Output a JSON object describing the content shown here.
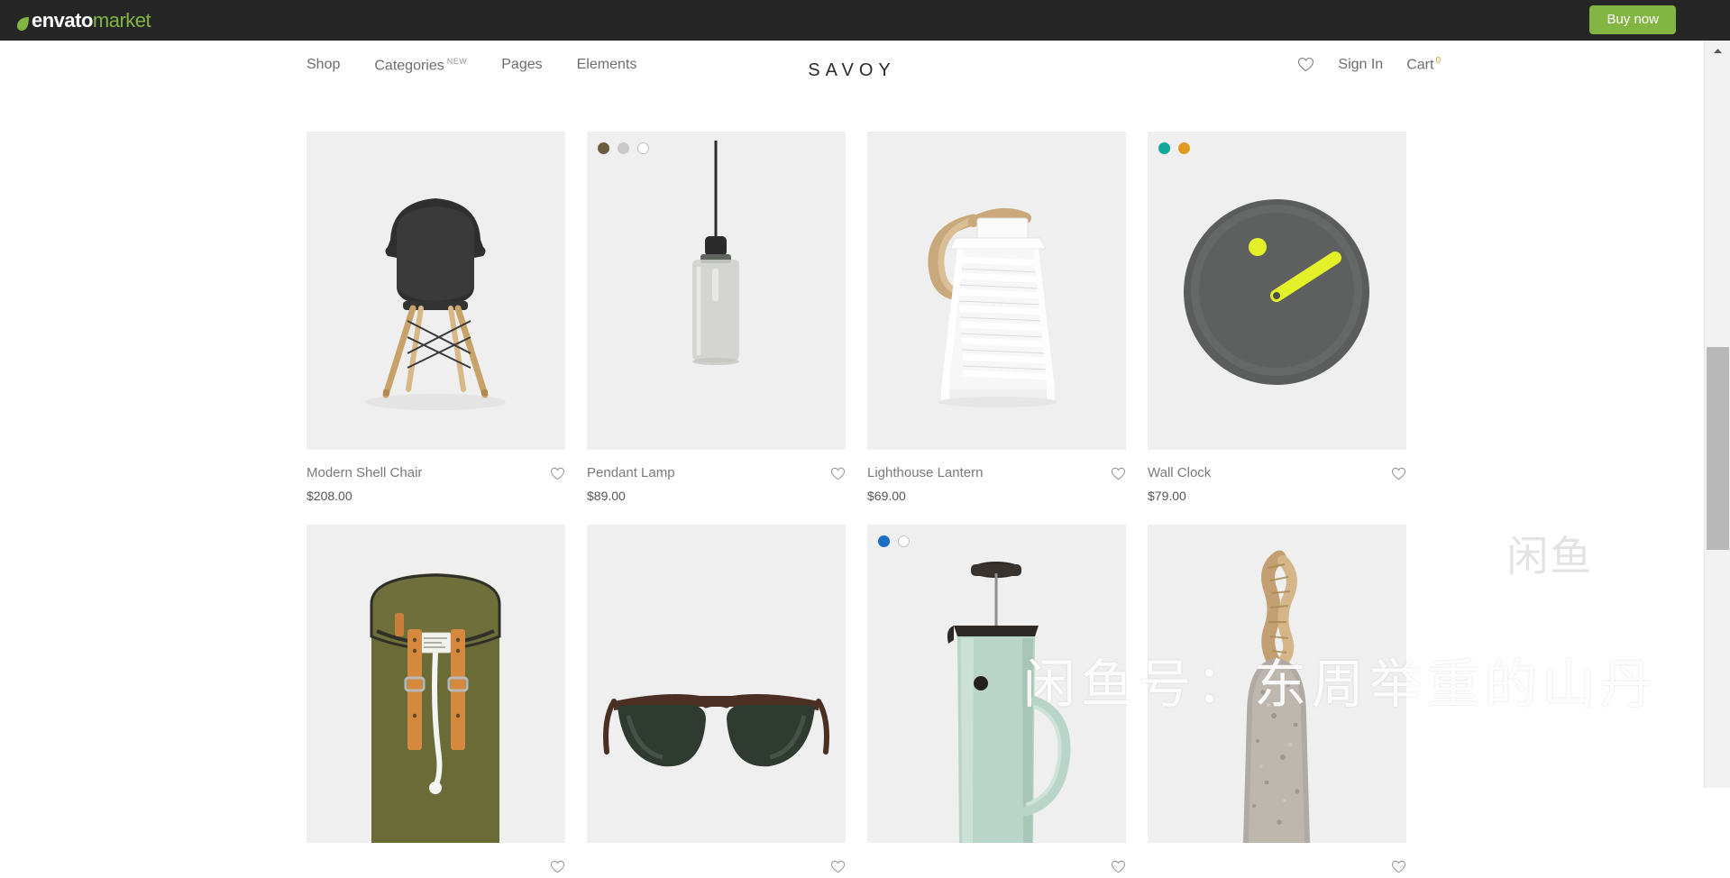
{
  "envato_bar": {
    "logo_envato": "envato",
    "logo_market": "market",
    "leaf_icon": "leaf-icon",
    "buy_now_label": "Buy now",
    "buy_now_color": "#82b541",
    "background": "#262626"
  },
  "header": {
    "brand": "SAVOY",
    "nav_items": [
      {
        "label": "Shop",
        "badge": ""
      },
      {
        "label": "Categories",
        "badge": "NEW"
      },
      {
        "label": "Pages",
        "badge": ""
      },
      {
        "label": "Elements",
        "badge": ""
      }
    ],
    "wishlist_icon": "heart-icon",
    "sign_in_label": "Sign In",
    "cart_label": "Cart",
    "cart_count": "0",
    "cart_count_color": "#d29a3a"
  },
  "products": [
    {
      "title": "Modern Shell Chair",
      "price": "$208.00",
      "swatches": [],
      "art": "shell-chair",
      "wishlist_icon": "heart-icon"
    },
    {
      "title": "Pendant Lamp",
      "price": "$89.00",
      "swatches": [
        "#6b5c3e",
        "#c9c9c9",
        "#ffffff"
      ],
      "art": "pendant-lamp",
      "wishlist_icon": "heart-icon"
    },
    {
      "title": "Lighthouse Lantern",
      "price": "$69.00",
      "swatches": [],
      "art": "lighthouse-lantern",
      "wishlist_icon": "heart-icon"
    },
    {
      "title": "Wall Clock",
      "price": "$79.00",
      "swatches": [
        "#11a89b",
        "#e09a22"
      ],
      "art": "wall-clock",
      "wishlist_icon": "heart-icon"
    },
    {
      "title": "",
      "price": "",
      "swatches": [],
      "art": "backpack",
      "wishlist_icon": "heart-icon"
    },
    {
      "title": "",
      "price": "",
      "swatches": [],
      "art": "sunglasses",
      "wishlist_icon": "heart-icon"
    },
    {
      "title": "",
      "price": "",
      "swatches": [
        "#1a6fc4",
        "#ffffff"
      ],
      "art": "press-coffee-maker",
      "wishlist_icon": "heart-icon"
    },
    {
      "title": "",
      "price": "",
      "swatches": [],
      "art": "stone-doorstop",
      "wishlist_icon": "heart-icon"
    }
  ],
  "watermark": {
    "app_logo_text": "闲鱼",
    "id_text": "闲鱼号：东周举重的山丹"
  },
  "scrollbar": {
    "up_arrow_icon": "chevron-up-icon",
    "thumb": "scroll-thumb"
  }
}
